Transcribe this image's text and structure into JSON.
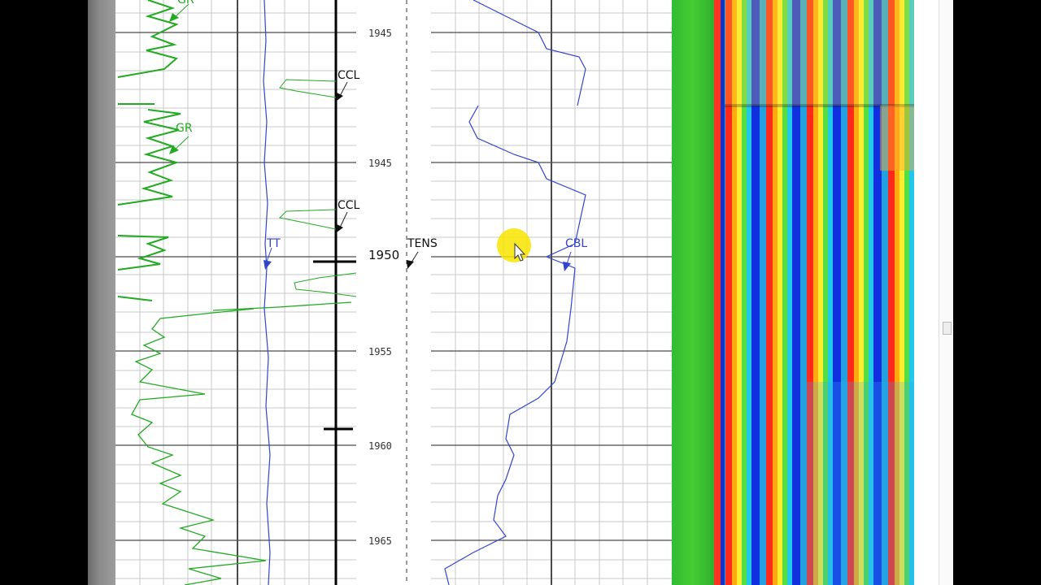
{
  "log": {
    "depth_labels": [
      "1945",
      "1945",
      "1950",
      "1955",
      "1960",
      "1965"
    ],
    "curve_labels": {
      "gr_top": "GR",
      "gr": "GR",
      "ccl_top": "CCL",
      "ccl": "CCL",
      "tt": "TT",
      "tens": "TENS",
      "cbl": "CBL"
    }
  },
  "colors": {
    "gr": "#22aa22",
    "tt": "#3344cc",
    "cbl": "#3344cc",
    "ccl": "#111111",
    "cursor_highlight": "#f7e400"
  },
  "icons": [
    "cursor-arrow-icon",
    "cursor-highlight-icon"
  ]
}
